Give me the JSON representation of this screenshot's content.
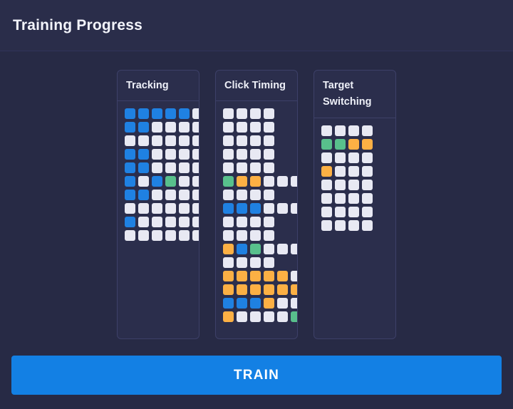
{
  "header": {
    "title": "Training Progress",
    "background": "#2a2d4a"
  },
  "theme": {
    "page_background": "#272a45",
    "panel_background": "#2b2e4c",
    "panel_border": "#3d4068",
    "text_primary": "#f3f4fb",
    "cell_empty": "#e8e9f3",
    "cell_blue": "#1f81e2",
    "cell_green": "#58c08c",
    "cell_orange": "#fcb044",
    "accent_button": "#1380e4"
  },
  "panels": [
    {
      "title": "Tracking",
      "columns": 6,
      "rows": [
        [
          "blue",
          "blue",
          "blue",
          "blue",
          "blue",
          "empty"
        ],
        [
          "blue",
          "blue",
          "empty",
          "empty",
          "empty",
          "empty"
        ],
        [
          "empty",
          "empty",
          "empty",
          "empty",
          "empty",
          "empty"
        ],
        [
          "blue",
          "blue",
          "empty",
          "empty",
          "empty",
          "empty"
        ],
        [
          "blue",
          "blue",
          "empty",
          "empty",
          "empty",
          "empty"
        ],
        [
          "blue",
          "empty",
          "blue",
          "green",
          "empty",
          "empty"
        ],
        [
          "blue",
          "blue",
          "empty",
          "empty",
          "empty",
          "empty"
        ],
        [
          "empty",
          "empty",
          "empty",
          "empty",
          "empty",
          "empty"
        ],
        [
          "blue",
          "empty",
          "empty",
          "empty",
          "empty",
          "empty"
        ],
        [
          "empty",
          "empty",
          "empty",
          "empty",
          "empty",
          "empty"
        ]
      ]
    },
    {
      "title": "Click Timing",
      "columns": 6,
      "rows": [
        [
          "empty",
          "empty",
          "empty",
          "empty"
        ],
        [
          "empty",
          "empty",
          "empty",
          "empty"
        ],
        [
          "empty",
          "empty",
          "empty",
          "empty"
        ],
        [
          "empty",
          "empty",
          "empty",
          "empty"
        ],
        [
          "empty",
          "empty",
          "empty",
          "empty"
        ],
        [
          "green",
          "orange",
          "orange",
          "empty",
          "empty",
          "empty"
        ],
        [
          "empty",
          "empty",
          "empty",
          "empty"
        ],
        [
          "blue",
          "blue",
          "blue",
          "empty",
          "empty",
          "empty"
        ],
        [
          "empty",
          "empty",
          "empty",
          "empty"
        ],
        [
          "empty",
          "empty",
          "empty",
          "empty"
        ],
        [
          "orange",
          "blue",
          "green",
          "empty",
          "empty",
          "empty"
        ],
        [
          "empty",
          "empty",
          "empty",
          "empty"
        ],
        [
          "orange",
          "orange",
          "orange",
          "orange",
          "orange",
          "empty"
        ],
        [
          "orange",
          "orange",
          "orange",
          "orange",
          "orange",
          "orange"
        ],
        [
          "blue",
          "blue",
          "blue",
          "orange",
          "empty",
          "empty"
        ],
        [
          "orange",
          "empty",
          "empty",
          "empty",
          "empty",
          "green"
        ]
      ]
    },
    {
      "title": "Target Switching",
      "columns": 4,
      "rows": [
        [
          "empty",
          "empty",
          "empty",
          "empty"
        ],
        [
          "green",
          "green",
          "orange",
          "orange"
        ],
        [
          "empty",
          "empty",
          "empty",
          "empty"
        ],
        [
          "orange",
          "empty",
          "empty",
          "empty"
        ],
        [
          "empty",
          "empty",
          "empty",
          "empty"
        ],
        [
          "empty",
          "empty",
          "empty",
          "empty"
        ],
        [
          "empty",
          "empty",
          "empty",
          "empty"
        ],
        [
          "empty",
          "empty",
          "empty",
          "empty"
        ]
      ]
    }
  ],
  "actions": {
    "train_label": "TRAIN"
  }
}
